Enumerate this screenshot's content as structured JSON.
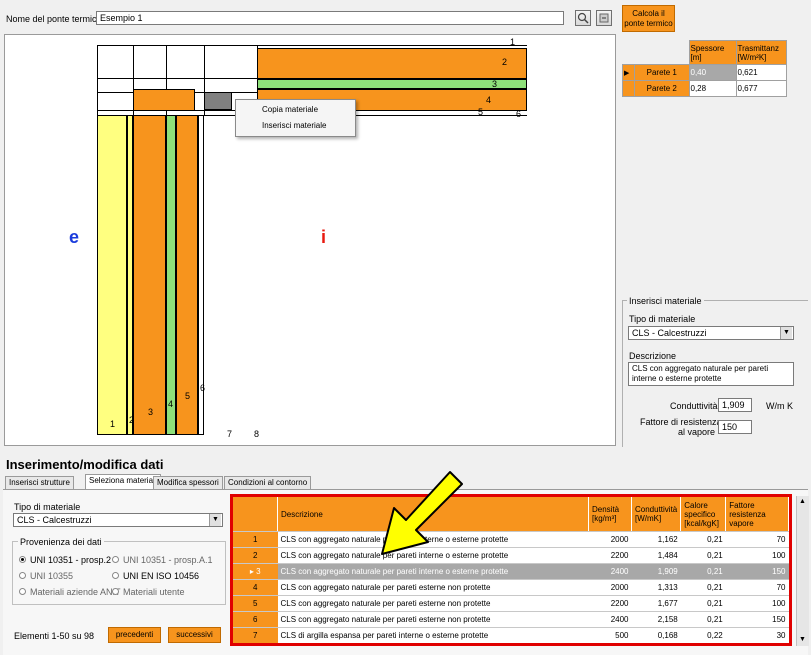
{
  "top": {
    "name_label": "Nome del ponte termico",
    "name_value": "Esempio 1",
    "calc_button": "Calcola il ponte termico"
  },
  "canvas": {
    "left_label": "e",
    "right_label": "i",
    "numbers_h": [
      "1",
      "2",
      "3",
      "4",
      "5",
      "6"
    ],
    "numbers_v": [
      "1",
      "2",
      "3",
      "4",
      "5",
      "6",
      "7",
      "8"
    ],
    "colors": {
      "orange": "#f7941d",
      "green": "#8ee07a",
      "yellow": "#ffff80",
      "gray": "#808080"
    }
  },
  "context_menu": {
    "items": [
      "Copia materiale",
      "Inserisci materiale"
    ]
  },
  "walls": {
    "headers": [
      "Spessore [m]",
      "Trasmittanz [W/m²K]"
    ],
    "rows": [
      {
        "label": "Parete 1",
        "spessore": "0,40",
        "trasm": "0,621"
      },
      {
        "label": "Parete 2",
        "spessore": "0,28",
        "trasm": "0,677"
      }
    ]
  },
  "insert_panel": {
    "group_title": "Inserisci materiale",
    "tipo_label": "Tipo di materiale",
    "tipo_value": "CLS - Calcestruzzi",
    "desc_label": "Descrizione",
    "desc_value": "CLS con aggregato naturale per pareti interne o esterne protette",
    "cond_label": "Conduttività",
    "cond_value": "1,909",
    "cond_unit": "W/m K",
    "vap_label1": "Fattore di resistenza",
    "vap_label2": "al vapore",
    "vap_value": "150"
  },
  "bottom": {
    "section_title": "Inserimento/modifica dati",
    "tabs": [
      "Inserisci strutture",
      "Seleziona materiali",
      "Modifica spessori",
      "Condizioni al contorno"
    ],
    "tipo_label": "Tipo di materiale",
    "tipo_value": "CLS - Calcestruzzi",
    "prov_title": "Provenienza dei dati",
    "radios": [
      "UNI 10351 - prosp.2",
      "UNI 10351 - prosp.A.1",
      "UNI 10355",
      "UNI EN ISO 10456",
      "Materiali aziende ANIT",
      "Materiali utente"
    ],
    "count_text": "Elementi 1-50 su 98",
    "prev_button": "precedenti",
    "next_button": "successivi"
  },
  "materials": {
    "headers": [
      "Descrizione",
      "Densità [kg/m³]",
      "Conduttività [W/mK]",
      "Calore specifico [kcal/kgK]",
      "Fattore resistenza vapore"
    ],
    "rows": [
      {
        "n": "1",
        "desc": "CLS con aggregato naturale per pareti interne o esterne protette",
        "dens": "2000",
        "cond": "1,162",
        "cal": "0,21",
        "vap": "70"
      },
      {
        "n": "2",
        "desc": "CLS con aggregato naturale per pareti interne o esterne protette",
        "dens": "2200",
        "cond": "1,484",
        "cal": "0,21",
        "vap": "100"
      },
      {
        "n": "3",
        "desc": "CLS con aggregato naturale per pareti interne o esterne protette",
        "dens": "2400",
        "cond": "1,909",
        "cal": "0,21",
        "vap": "150"
      },
      {
        "n": "4",
        "desc": "CLS con aggregato naturale per pareti esterne non protette",
        "dens": "2000",
        "cond": "1,313",
        "cal": "0,21",
        "vap": "70"
      },
      {
        "n": "5",
        "desc": "CLS con aggregato naturale per pareti esterne non protette",
        "dens": "2200",
        "cond": "1,677",
        "cal": "0,21",
        "vap": "100"
      },
      {
        "n": "6",
        "desc": "CLS con aggregato naturale per pareti esterne non protette",
        "dens": "2400",
        "cond": "2,158",
        "cal": "0,21",
        "vap": "150"
      },
      {
        "n": "7",
        "desc": "CLS di argilla espansa per pareti interne o esterne protette",
        "dens": "500",
        "cond": "0,168",
        "cal": "0,22",
        "vap": "30"
      }
    ]
  }
}
